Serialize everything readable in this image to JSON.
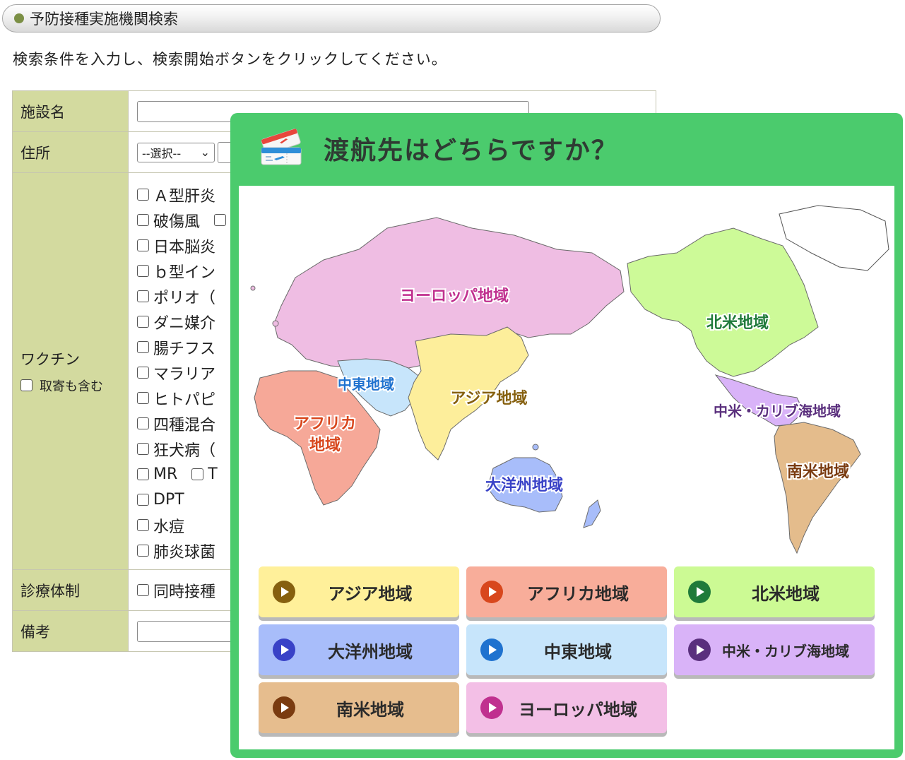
{
  "page": {
    "header_title": "予防接種実施機関検索",
    "instructions": "検索条件を入力し、検索開始ボタンをクリックしてください。"
  },
  "form": {
    "facility_label": "施設名",
    "address_label": "住所",
    "address_select": "--選択--",
    "vaccine_label": "ワクチン",
    "vaccine_include_label": "取寄も含む",
    "vaccines": [
      {
        "label": "Ａ型肝炎",
        "extra": ""
      },
      {
        "label": "破傷風",
        "extra": "["
      },
      {
        "label": "日本脳炎",
        "extra": ""
      },
      {
        "label": "ｂ型イン",
        "extra": ""
      },
      {
        "label": "ポリオ（",
        "extra": ""
      },
      {
        "label": "ダニ媒介",
        "extra": ""
      },
      {
        "label": "腸チフス",
        "extra": ""
      },
      {
        "label": "マラリア",
        "extra": ""
      },
      {
        "label": "ヒトパピ",
        "extra": ""
      },
      {
        "label": "四種混合",
        "extra": ""
      },
      {
        "label": "狂犬病（",
        "extra": ""
      },
      {
        "label": "MR",
        "extra": "T"
      },
      {
        "label": "DPT",
        "extra": ""
      },
      {
        "label": "水痘",
        "extra": ""
      },
      {
        "label": "肺炎球菌",
        "extra": ""
      }
    ],
    "system_label": "診療体制",
    "system_option": "同時接種",
    "notes_label": "備考"
  },
  "modal": {
    "title": "渡航先はどちらですか？",
    "icon": "airline-tickets-icon",
    "map_labels": {
      "europe": "ヨーロッパ地域",
      "north_america": "北米地域",
      "middle_east": "中東地域",
      "asia": "アジア地域",
      "central_america": "中米・カリブ海地域",
      "africa_1": "アフリカ",
      "africa_2": "地域",
      "south_america": "南米地域",
      "oceania": "大洋州地域"
    },
    "regions": [
      {
        "key": "asia",
        "label": "アジア地域",
        "bg": "#fff09a",
        "icon": "#86600f"
      },
      {
        "key": "africa",
        "label": "アフリカ地域",
        "bg": "#f8ad9a",
        "icon": "#d8471d"
      },
      {
        "key": "north_america",
        "label": "北米地域",
        "bg": "#ccfa94",
        "icon": "#1f7a3a"
      },
      {
        "key": "oceania",
        "label": "大洋州地域",
        "bg": "#a8bdfa",
        "icon": "#3942c7"
      },
      {
        "key": "middle_east",
        "label": "中東地域",
        "bg": "#c7e5fb",
        "icon": "#1f72cf"
      },
      {
        "key": "central_america",
        "label": "中米・カリブ海地域",
        "bg": "#d9b3f8",
        "icon": "#5a2f7d"
      },
      {
        "key": "south_america",
        "label": "南米地域",
        "bg": "#e6bd8e",
        "icon": "#7a3b10"
      },
      {
        "key": "europe",
        "label": "ヨーロッパ地域",
        "bg": "#f3bfe6",
        "icon": "#c0308f"
      }
    ]
  }
}
